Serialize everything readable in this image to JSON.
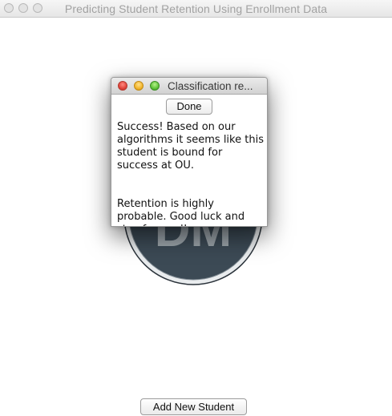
{
  "window": {
    "title": "Predicting Student Retention Using Enrollment Data"
  },
  "logo": {
    "text": "DM",
    "colors": {
      "face": "#3c4a55",
      "rim": "#e9ecee",
      "outline": "#2a323a"
    }
  },
  "dialog": {
    "title": "Classification re...",
    "done_label": "Done",
    "message_success": "Success! Based on our algorithms it seems like this student is bound for success at OU.",
    "message_retention": "Retention is highly probable. Good luck and stay focused!"
  },
  "main": {
    "add_student_label": "Add New Student"
  }
}
